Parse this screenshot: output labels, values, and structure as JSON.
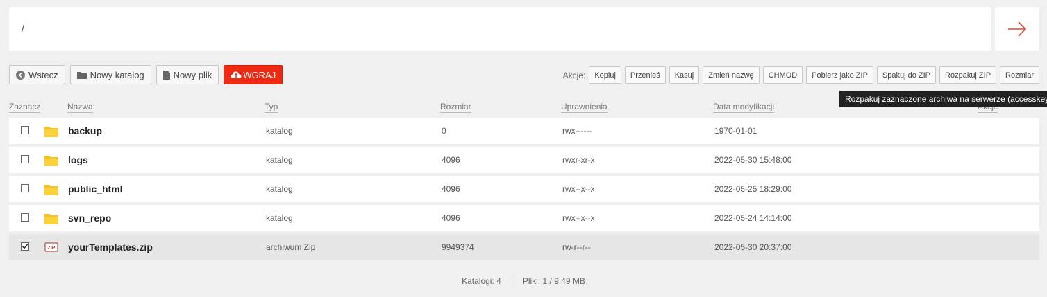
{
  "path": {
    "value": "/"
  },
  "toolbar": {
    "back": "Wstecz",
    "new_folder": "Nowy katalog",
    "new_file": "Nowy plik",
    "upload": "WGRAJ"
  },
  "actions": {
    "label": "Akcje:",
    "buttons": [
      "Kopiuj",
      "Przenieś",
      "Kasuj",
      "Zmień nazwę",
      "CHMOD",
      "Pobierz jako ZIP",
      "Spakuj do ZIP",
      "Rozpakuj ZIP",
      "Rozmiar"
    ]
  },
  "tooltip": "Rozpakuj zaznaczone archiwa na serwerze (accesskey i)",
  "columns": {
    "select": "Zaznacz",
    "name": "Nazwa",
    "type": "Typ",
    "size": "Rozmiar",
    "perms": "Uprawnienia",
    "modified": "Data modyfikacji",
    "actions": "Akcje"
  },
  "files": [
    {
      "name": "backup",
      "type": "katalog",
      "size": "0",
      "perms": "rwx------",
      "modified": "1970-01-01",
      "icon": "folder-icon",
      "checked": false
    },
    {
      "name": "logs",
      "type": "katalog",
      "size": "4096",
      "perms": "rwxr-xr-x",
      "modified": "2022-05-30 15:48:00",
      "icon": "folder-icon",
      "checked": false
    },
    {
      "name": "public_html",
      "type": "katalog",
      "size": "4096",
      "perms": "rwx--x--x",
      "modified": "2022-05-25 18:29:00",
      "icon": "folder-icon",
      "checked": false
    },
    {
      "name": "svn_repo",
      "type": "katalog",
      "size": "4096",
      "perms": "rwx--x--x",
      "modified": "2022-05-24 14:14:00",
      "icon": "folder-icon",
      "checked": false
    },
    {
      "name": "yourTemplates.zip",
      "type": "archiwum Zip",
      "size": "9949374",
      "perms": "rw-r--r--",
      "modified": "2022-05-30 20:37:00",
      "icon": "zip-icon",
      "checked": true
    }
  ],
  "footer": {
    "folders": "Katalogi: 4",
    "files": "Pliki: 1 / 9.49 MB"
  },
  "colors": {
    "accent": "#ee2a12",
    "folder": "#f7c21b"
  }
}
